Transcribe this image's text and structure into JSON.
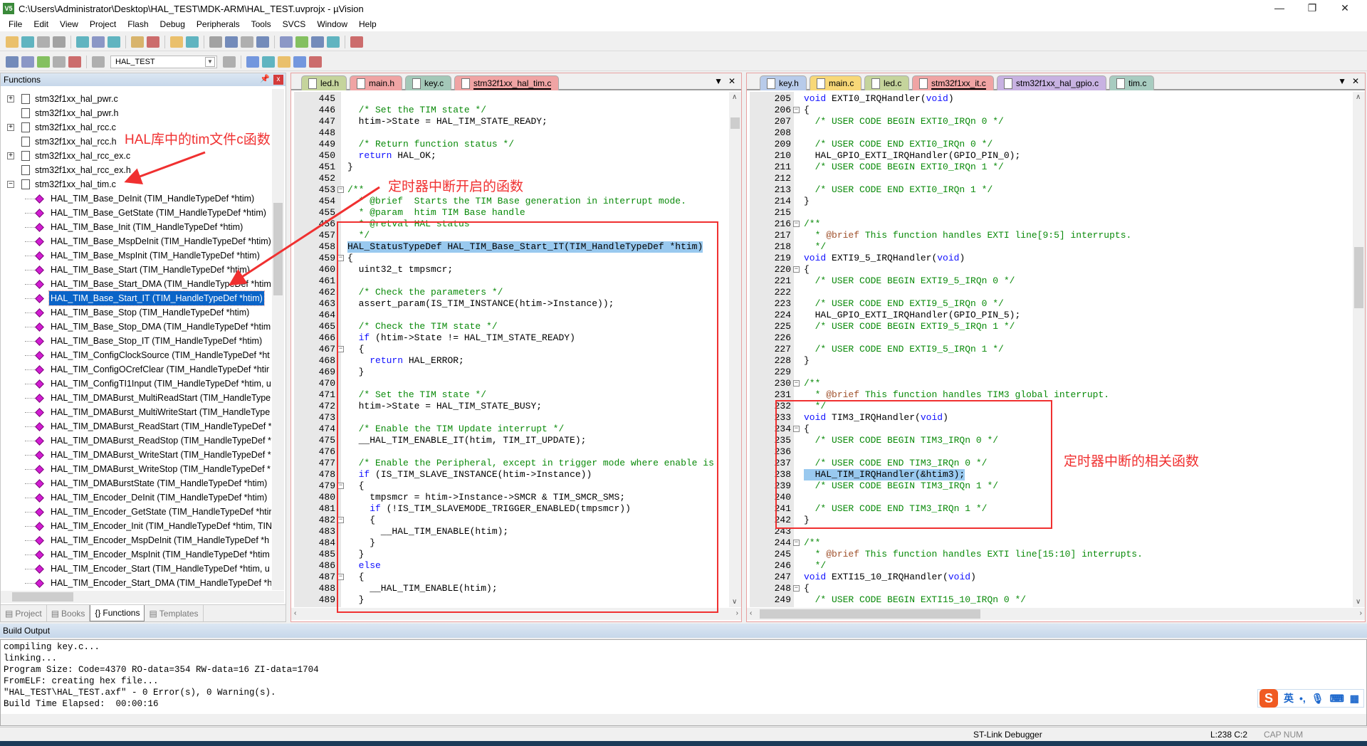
{
  "window": {
    "title": "C:\\Users\\Administrator\\Desktop\\HAL_TEST\\MDK-ARM\\HAL_TEST.uvprojx - µVision",
    "app_icon_text": "V5"
  },
  "menu": [
    "File",
    "Edit",
    "View",
    "Project",
    "Flash",
    "Debug",
    "Peripherals",
    "Tools",
    "SVCS",
    "Window",
    "Help"
  ],
  "toolbar1_icons": [
    "new-file-icon",
    "open-folder-icon",
    "save-icon",
    "save-all-icon",
    "|",
    "cut-icon",
    "copy-icon",
    "paste-icon",
    "|",
    "undo-icon",
    "redo-icon",
    "|",
    "nav-back-icon",
    "nav-forward-icon",
    "|",
    "bookmark-icon",
    "prev-bookmark-icon",
    "next-bookmark-icon",
    "clear-bookmarks-icon",
    "|",
    "indent-icon",
    "unindent-icon",
    "comment-icon",
    "uncomment-icon",
    "|",
    "find-in-files-icon"
  ],
  "toolbar2_icons": [
    "translate-icon",
    "build-icon",
    "rebuild-icon",
    "batch-build-icon",
    "stop-build-icon",
    "|",
    "download-icon"
  ],
  "toolbar2_icons_right": [
    "target-options-icon",
    "|",
    "manage-components-icon",
    "multi-project-icon",
    "run-time-env-icon",
    "pack-installer-icon",
    "select-packs-icon"
  ],
  "target": {
    "value": "HAL_TEST"
  },
  "left_panel": {
    "title": "Functions",
    "files": [
      {
        "name": "stm32f1xx_hal_pwr.c",
        "expand": "+"
      },
      {
        "name": "stm32f1xx_hal_pwr.h",
        "expand": ""
      },
      {
        "name": "stm32f1xx_hal_rcc.c",
        "expand": "+"
      },
      {
        "name": "stm32f1xx_hal_rcc.h",
        "expand": ""
      },
      {
        "name": "stm32f1xx_hal_rcc_ex.c",
        "expand": "+"
      },
      {
        "name": "stm32f1xx_hal_rcc_ex.h",
        "expand": ""
      },
      {
        "name": "stm32f1xx_hal_tim.c",
        "expand": "−"
      }
    ],
    "functions": [
      "HAL_TIM_Base_DeInit (TIM_HandleTypeDef *htim)",
      "HAL_TIM_Base_GetState (TIM_HandleTypeDef *htim)",
      "HAL_TIM_Base_Init (TIM_HandleTypeDef *htim)",
      "HAL_TIM_Base_MspDeInit (TIM_HandleTypeDef *htim)",
      "HAL_TIM_Base_MspInit (TIM_HandleTypeDef *htim)",
      "HAL_TIM_Base_Start (TIM_HandleTypeDef *htim)",
      "HAL_TIM_Base_Start_DMA (TIM_HandleTypeDef *htim",
      "HAL_TIM_Base_Start_IT (TIM_HandleTypeDef *htim)",
      "HAL_TIM_Base_Stop (TIM_HandleTypeDef *htim)",
      "HAL_TIM_Base_Stop_DMA (TIM_HandleTypeDef *htim",
      "HAL_TIM_Base_Stop_IT (TIM_HandleTypeDef *htim)",
      "HAL_TIM_ConfigClockSource (TIM_HandleTypeDef *ht",
      "HAL_TIM_ConfigOCrefClear (TIM_HandleTypeDef *htir",
      "HAL_TIM_ConfigTI1Input (TIM_HandleTypeDef *htim, u",
      "HAL_TIM_DMABurst_MultiReadStart (TIM_HandleType",
      "HAL_TIM_DMABurst_MultiWriteStart (TIM_HandleType",
      "HAL_TIM_DMABurst_ReadStart (TIM_HandleTypeDef *",
      "HAL_TIM_DMABurst_ReadStop (TIM_HandleTypeDef *",
      "HAL_TIM_DMABurst_WriteStart (TIM_HandleTypeDef *",
      "HAL_TIM_DMABurst_WriteStop (TIM_HandleTypeDef *",
      "HAL_TIM_DMABurstState (TIM_HandleTypeDef *htim)",
      "HAL_TIM_Encoder_DeInit (TIM_HandleTypeDef *htim)",
      "HAL_TIM_Encoder_GetState (TIM_HandleTypeDef *htir",
      "HAL_TIM_Encoder_Init (TIM_HandleTypeDef *htim, TIN",
      "HAL_TIM_Encoder_MspDeInit (TIM_HandleTypeDef *h",
      "HAL_TIM_Encoder_MspInit (TIM_HandleTypeDef *htim",
      "HAL_TIM_Encoder_Start (TIM_HandleTypeDef *htim, u",
      "HAL_TIM_Encoder_Start_DMA (TIM_HandleTypeDef *h"
    ],
    "selected_function": "HAL_TIM_Base_Start_IT (TIM_HandleTypeDef *htim)",
    "tabs": [
      {
        "label": "Project",
        "icon": "project-icon",
        "active": false
      },
      {
        "label": "Books",
        "icon": "books-icon",
        "active": false
      },
      {
        "label": "Functions",
        "icon": "functions-icon",
        "active": true
      },
      {
        "label": "Templates",
        "icon": "templates-icon",
        "active": false
      }
    ]
  },
  "editor_left": {
    "tabs": [
      {
        "label": "led.h",
        "color": "#c5d49c",
        "active": false
      },
      {
        "label": "main.h",
        "color": "#f0a4a4",
        "active": false
      },
      {
        "label": "key.c",
        "color": "#a4c8b8",
        "active": false
      },
      {
        "label": "stm32f1xx_hal_tim.c",
        "color": "#f0a4a4",
        "active": true
      }
    ],
    "lines": [
      {
        "n": 445,
        "t": ""
      },
      {
        "n": 446,
        "t": "  /* Set the TIM state */"
      },
      {
        "n": 447,
        "t": "  htim->State = HAL_TIM_STATE_READY;"
      },
      {
        "n": 448,
        "t": ""
      },
      {
        "n": 449,
        "t": "  /* Return function status */"
      },
      {
        "n": 450,
        "t": "  return HAL_OK;"
      },
      {
        "n": 451,
        "t": "}"
      },
      {
        "n": 452,
        "t": ""
      },
      {
        "n": 453,
        "t": "/**",
        "fold": true
      },
      {
        "n": 454,
        "t": "  * @brief  Starts the TIM Base generation in interrupt mode."
      },
      {
        "n": 455,
        "t": "  * @param  htim TIM Base handle"
      },
      {
        "n": 456,
        "t": "  * @retval HAL status"
      },
      {
        "n": 457,
        "t": "  */"
      },
      {
        "n": 458,
        "t": "HAL_StatusTypeDef HAL_TIM_Base_Start_IT(TIM_HandleTypeDef *htim)",
        "hl": true
      },
      {
        "n": 459,
        "t": "{",
        "fold": true
      },
      {
        "n": 460,
        "t": "  uint32_t tmpsmcr;"
      },
      {
        "n": 461,
        "t": ""
      },
      {
        "n": 462,
        "t": "  /* Check the parameters */"
      },
      {
        "n": 463,
        "t": "  assert_param(IS_TIM_INSTANCE(htim->Instance));"
      },
      {
        "n": 464,
        "t": ""
      },
      {
        "n": 465,
        "t": "  /* Check the TIM state */"
      },
      {
        "n": 466,
        "t": "  if (htim->State != HAL_TIM_STATE_READY)"
      },
      {
        "n": 467,
        "t": "  {",
        "fold": true
      },
      {
        "n": 468,
        "t": "    return HAL_ERROR;"
      },
      {
        "n": 469,
        "t": "  }"
      },
      {
        "n": 470,
        "t": ""
      },
      {
        "n": 471,
        "t": "  /* Set the TIM state */"
      },
      {
        "n": 472,
        "t": "  htim->State = HAL_TIM_STATE_BUSY;"
      },
      {
        "n": 473,
        "t": ""
      },
      {
        "n": 474,
        "t": "  /* Enable the TIM Update interrupt */"
      },
      {
        "n": 475,
        "t": "  __HAL_TIM_ENABLE_IT(htim, TIM_IT_UPDATE);"
      },
      {
        "n": 476,
        "t": ""
      },
      {
        "n": 477,
        "t": "  /* Enable the Peripheral, except in trigger mode where enable is"
      },
      {
        "n": 478,
        "t": "  if (IS_TIM_SLAVE_INSTANCE(htim->Instance))"
      },
      {
        "n": 479,
        "t": "  {",
        "fold": true
      },
      {
        "n": 480,
        "t": "    tmpsmcr = htim->Instance->SMCR & TIM_SMCR_SMS;"
      },
      {
        "n": 481,
        "t": "    if (!IS_TIM_SLAVEMODE_TRIGGER_ENABLED(tmpsmcr))"
      },
      {
        "n": 482,
        "t": "    {",
        "fold": true
      },
      {
        "n": 483,
        "t": "      __HAL_TIM_ENABLE(htim);"
      },
      {
        "n": 484,
        "t": "    }"
      },
      {
        "n": 485,
        "t": "  }"
      },
      {
        "n": 486,
        "t": "  else"
      },
      {
        "n": 487,
        "t": "  {",
        "fold": true
      },
      {
        "n": 488,
        "t": "    __HAL_TIM_ENABLE(htim);"
      },
      {
        "n": 489,
        "t": "  }"
      }
    ]
  },
  "editor_right": {
    "tabs": [
      {
        "label": "key.h",
        "color": "#b8cbea",
        "active": false
      },
      {
        "label": "main.c",
        "color": "#f8d878",
        "active": false
      },
      {
        "label": "led.c",
        "color": "#c5d49c",
        "active": false
      },
      {
        "label": "stm32f1xx_it.c",
        "color": "#f0a4a4",
        "active": true
      },
      {
        "label": "stm32f1xx_hal_gpio.c",
        "color": "#c8b2e2",
        "active": false
      },
      {
        "label": "tim.c",
        "color": "#a8ccc0",
        "active": false
      }
    ],
    "lines": [
      {
        "n": 205,
        "t": "void EXTI0_IRQHandler(void)"
      },
      {
        "n": 206,
        "t": "{",
        "fold": true
      },
      {
        "n": 207,
        "t": "  /* USER CODE BEGIN EXTI0_IRQn 0 */"
      },
      {
        "n": 208,
        "t": ""
      },
      {
        "n": 209,
        "t": "  /* USER CODE END EXTI0_IRQn 0 */"
      },
      {
        "n": 210,
        "t": "  HAL_GPIO_EXTI_IRQHandler(GPIO_PIN_0);"
      },
      {
        "n": 211,
        "t": "  /* USER CODE BEGIN EXTI0_IRQn 1 */"
      },
      {
        "n": 212,
        "t": ""
      },
      {
        "n": 213,
        "t": "  /* USER CODE END EXTI0_IRQn 1 */"
      },
      {
        "n": 214,
        "t": "}"
      },
      {
        "n": 215,
        "t": ""
      },
      {
        "n": 216,
        "t": "/**",
        "fold": true
      },
      {
        "n": 217,
        "t": "  * @brief This function handles EXTI line[9:5] interrupts."
      },
      {
        "n": 218,
        "t": "  */"
      },
      {
        "n": 219,
        "t": "void EXTI9_5_IRQHandler(void)"
      },
      {
        "n": 220,
        "t": "{",
        "fold": true
      },
      {
        "n": 221,
        "t": "  /* USER CODE BEGIN EXTI9_5_IRQn 0 */"
      },
      {
        "n": 222,
        "t": ""
      },
      {
        "n": 223,
        "t": "  /* USER CODE END EXTI9_5_IRQn 0 */"
      },
      {
        "n": 224,
        "t": "  HAL_GPIO_EXTI_IRQHandler(GPIO_PIN_5);"
      },
      {
        "n": 225,
        "t": "  /* USER CODE BEGIN EXTI9_5_IRQn 1 */"
      },
      {
        "n": 226,
        "t": ""
      },
      {
        "n": 227,
        "t": "  /* USER CODE END EXTI9_5_IRQn 1 */"
      },
      {
        "n": 228,
        "t": "}"
      },
      {
        "n": 229,
        "t": ""
      },
      {
        "n": 230,
        "t": "/**",
        "fold": true
      },
      {
        "n": 231,
        "t": "  * @brief This function handles TIM3 global interrupt."
      },
      {
        "n": 232,
        "t": "  */"
      },
      {
        "n": 233,
        "t": "void TIM3_IRQHandler(void)"
      },
      {
        "n": 234,
        "t": "{",
        "fold": true
      },
      {
        "n": 235,
        "t": "  /* USER CODE BEGIN TIM3_IRQn 0 */"
      },
      {
        "n": 236,
        "t": ""
      },
      {
        "n": 237,
        "t": "  /* USER CODE END TIM3_IRQn 0 */"
      },
      {
        "n": 238,
        "t": "  HAL_TIM_IRQHandler(&htim3);",
        "hl": true
      },
      {
        "n": 239,
        "t": "  /* USER CODE BEGIN TIM3_IRQn 1 */"
      },
      {
        "n": 240,
        "t": ""
      },
      {
        "n": 241,
        "t": "  /* USER CODE END TIM3_IRQn 1 */"
      },
      {
        "n": 242,
        "t": "}"
      },
      {
        "n": 243,
        "t": ""
      },
      {
        "n": 244,
        "t": "/**",
        "fold": true
      },
      {
        "n": 245,
        "t": "  * @brief This function handles EXTI line[15:10] interrupts."
      },
      {
        "n": 246,
        "t": "  */"
      },
      {
        "n": 247,
        "t": "void EXTI15_10_IRQHandler(void)"
      },
      {
        "n": 248,
        "t": "{",
        "fold": true
      },
      {
        "n": 249,
        "t": "  /* USER CODE BEGIN EXTI15_10_IRQn 0 */"
      }
    ]
  },
  "annotations": {
    "tim_file": "HAL库中的tim文件c函数",
    "start_it": "定时器中断开启的函数",
    "irq": "定时器中断的相关函数"
  },
  "build_output": {
    "title": "Build Output",
    "lines": [
      "compiling key.c...",
      "linking...",
      "Program Size: Code=4370 RO-data=354 RW-data=16 ZI-data=1704",
      "FromELF: creating hex file...",
      "\"HAL_TEST\\HAL_TEST.axf\" - 0 Error(s), 0 Warning(s).",
      "Build Time Elapsed:  00:00:16"
    ]
  },
  "ime": {
    "logo": "S",
    "lang": "英",
    "punct": "•,"
  },
  "status": {
    "debugger": "ST-Link Debugger",
    "position": "L:238 C:2",
    "indicators": "CAP NUM"
  },
  "colors": {
    "annotation": "#f03030",
    "selection": "#0a64c8",
    "highlight": "#99c9ef",
    "comment": "#0a8a0a",
    "keyword": "#1010ff"
  }
}
